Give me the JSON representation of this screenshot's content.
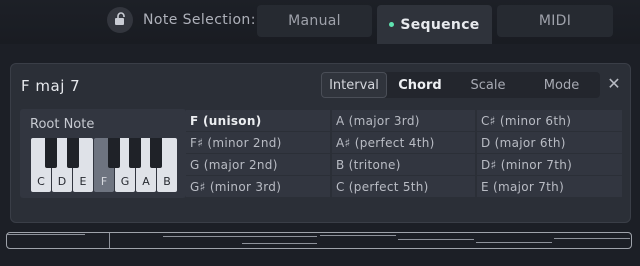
{
  "header": {
    "note_selection_label": "Note Selection:",
    "modes": [
      "Manual",
      "Sequence",
      "MIDI"
    ],
    "active_mode": "Sequence",
    "accent": "#5fe3b0"
  },
  "panel": {
    "chord_name": "F maj 7",
    "tabs": [
      "Interval",
      "Chord",
      "Scale",
      "Mode"
    ],
    "selected_tab": "Chord",
    "close_symbol": "✕",
    "root_note_label": "Root Note",
    "white_keys": [
      "C",
      "D",
      "E",
      "F",
      "G",
      "A",
      "B"
    ],
    "root_note": "F",
    "intervals": [
      [
        "F  (unison)",
        "A  (major 3rd)",
        "C♯ (minor 6th)"
      ],
      [
        "F♯ (minor 2nd)",
        "A♯ (perfect 4th)",
        "D  (major 6th)"
      ],
      [
        "G  (major 2nd)",
        "B  (tritone)",
        "D♯ (minor 7th)"
      ],
      [
        "G♯ (minor 3rd)",
        "C  (perfect 5th)",
        "E  (major 7th)"
      ]
    ]
  }
}
